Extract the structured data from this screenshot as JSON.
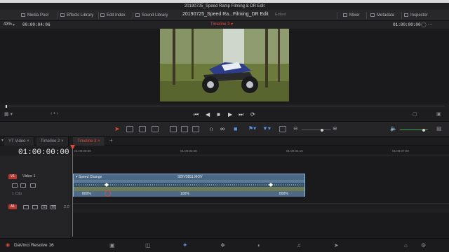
{
  "window": {
    "title": "20190725_Speed Ramp Filming & DR Edit"
  },
  "toolbar": {
    "media_pool": "Media Pool",
    "effects_library": "Effects Library",
    "edit_index": "Edit Index",
    "sound_library": "Sound Library",
    "project_title": "20190725_Speed Ra...Filming_DR Edit",
    "edited": "Edited",
    "mixer": "Mixer",
    "metadata": "Metadata",
    "inspector": "Inspector"
  },
  "viewer": {
    "zoom": "43%",
    "source_timecode": "00:00:04:06",
    "timeline_name": "Timeline 3",
    "record_timecode": "01:00:00:00"
  },
  "timeline_tabs": [
    "YT Video",
    "Timeline 2",
    "Timeline 3"
  ],
  "timeline": {
    "timecode": "01:00:00:00",
    "ruler_labels": [
      "01:00:00:00",
      "01:00:02:08",
      "01:00:04:16",
      "01:00:07:00"
    ]
  },
  "tracks": {
    "video": {
      "id": "V1",
      "name": "Video 1",
      "clip_count": "1 Clip"
    },
    "audio": {
      "id": "A1",
      "solo": "S",
      "mute": "M",
      "level": "2.0"
    }
  },
  "clip": {
    "effect": "Speed Change",
    "name": "SDIV3851.MOV",
    "speeds": [
      "800%",
      "100%",
      "800%"
    ]
  },
  "app": {
    "name": "DaVinci Resolve 16"
  },
  "colors": {
    "accent_red": "#e0483c",
    "clip_blue": "#5d7a96",
    "bg": "#1e1e21"
  }
}
